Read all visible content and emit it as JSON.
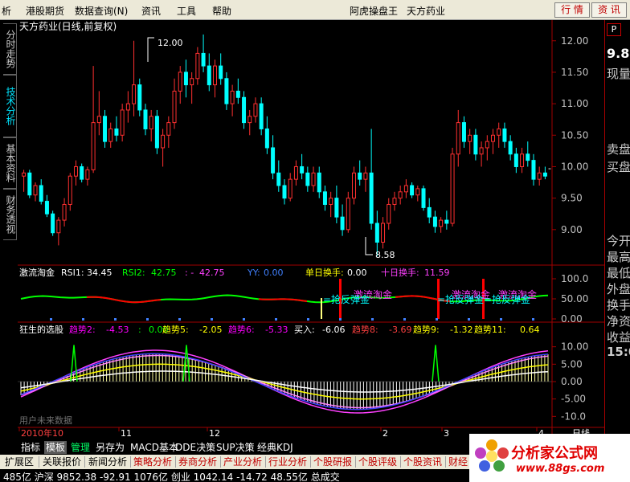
{
  "menubar": {
    "items": [
      "析",
      "港股期货",
      "数据查询(N)",
      "资讯",
      "工具",
      "帮助"
    ],
    "app_title": "阿虎操盘王",
    "stock_title": "天方药业",
    "btn_quote": "行 情",
    "btn_info": "资 讯",
    "win_min": "—",
    "win_restore": "❐",
    "win_close": "✕"
  },
  "left_tabs": [
    "分时走势",
    "技术分析",
    "基本资料",
    "财务透视"
  ],
  "chart": {
    "title": "天方药业(日线,前复权)",
    "high_label": "12.00",
    "low_label": "8.58",
    "price_ticks": [
      "12.00",
      "11.50",
      "11.00",
      "10.50",
      "10.00",
      "9.50",
      "9.00"
    ],
    "current_mark": "-",
    "candles": [
      [
        9.85,
        9.95,
        9.6,
        9.9
      ],
      [
        9.9,
        9.95,
        9.5,
        9.55
      ],
      [
        9.55,
        9.75,
        9.45,
        9.7
      ],
      [
        9.7,
        9.8,
        9.4,
        9.45
      ],
      [
        9.45,
        9.55,
        9.2,
        9.25
      ],
      [
        9.25,
        9.3,
        8.9,
        8.95
      ],
      [
        8.95,
        9.2,
        8.75,
        9.15
      ],
      [
        9.15,
        9.5,
        9.05,
        9.4
      ],
      [
        9.4,
        9.9,
        9.3,
        9.85
      ],
      [
        9.85,
        10.1,
        9.7,
        10.0
      ],
      [
        10.0,
        10.05,
        9.75,
        9.8
      ],
      [
        9.8,
        10.0,
        9.7,
        9.95
      ],
      [
        9.95,
        11.6,
        9.9,
        10.7
      ],
      [
        10.7,
        11.2,
        10.5,
        10.8
      ],
      [
        10.8,
        10.9,
        10.3,
        10.4
      ],
      [
        10.4,
        10.7,
        10.3,
        10.6
      ],
      [
        10.6,
        10.8,
        10.4,
        10.5
      ],
      [
        10.5,
        11.0,
        10.4,
        10.9
      ],
      [
        10.9,
        11.2,
        10.7,
        11.0
      ],
      [
        11.0,
        12.0,
        10.8,
        11.3
      ],
      [
        11.3,
        11.4,
        10.8,
        10.9
      ],
      [
        10.9,
        11.0,
        10.5,
        10.6
      ],
      [
        10.6,
        10.9,
        10.4,
        10.8
      ],
      [
        10.8,
        10.9,
        10.2,
        10.3
      ],
      [
        10.3,
        10.6,
        10.0,
        10.5
      ],
      [
        10.5,
        10.8,
        10.3,
        10.7
      ],
      [
        10.7,
        11.4,
        10.6,
        11.2
      ],
      [
        11.2,
        11.6,
        11.0,
        11.5
      ],
      [
        11.5,
        11.7,
        11.1,
        11.3
      ],
      [
        11.3,
        11.5,
        11.0,
        11.4
      ],
      [
        11.4,
        11.9,
        11.3,
        11.8
      ],
      [
        11.8,
        12.1,
        11.5,
        11.6
      ],
      [
        11.6,
        11.8,
        11.2,
        11.3
      ],
      [
        11.3,
        11.7,
        11.1,
        11.6
      ],
      [
        11.6,
        11.8,
        11.3,
        11.4
      ],
      [
        11.4,
        11.5,
        10.9,
        11.0
      ],
      [
        11.0,
        11.3,
        10.8,
        11.2
      ],
      [
        11.2,
        11.4,
        11.0,
        11.1
      ],
      [
        11.1,
        11.2,
        10.6,
        10.7
      ],
      [
        10.7,
        10.9,
        10.5,
        10.8
      ],
      [
        10.8,
        11.1,
        10.7,
        11.0
      ],
      [
        11.0,
        11.1,
        10.5,
        10.6
      ],
      [
        10.6,
        10.8,
        10.2,
        10.3
      ],
      [
        10.3,
        10.5,
        9.8,
        9.9
      ],
      [
        9.9,
        10.1,
        9.6,
        9.7
      ],
      [
        9.7,
        9.8,
        9.4,
        9.5
      ],
      [
        9.5,
        9.9,
        9.45,
        9.8
      ],
      [
        9.8,
        10.1,
        9.7,
        10.0
      ],
      [
        10.0,
        10.2,
        9.8,
        9.9
      ],
      [
        9.9,
        10.0,
        9.6,
        9.7
      ],
      [
        9.7,
        10.0,
        9.6,
        9.9
      ],
      [
        9.9,
        10.0,
        9.5,
        9.6
      ],
      [
        9.6,
        9.7,
        9.3,
        9.4
      ],
      [
        9.4,
        9.6,
        9.2,
        9.5
      ],
      [
        9.5,
        9.7,
        9.1,
        9.2
      ],
      [
        9.2,
        9.4,
        8.9,
        9.0
      ],
      [
        9.0,
        9.6,
        8.95,
        9.5
      ],
      [
        9.5,
        10.0,
        9.4,
        9.9
      ],
      [
        9.9,
        10.1,
        9.7,
        9.8
      ],
      [
        9.8,
        10.0,
        9.6,
        9.9
      ],
      [
        9.9,
        10.6,
        9.0,
        9.1
      ],
      [
        9.1,
        9.3,
        8.58,
        8.8
      ],
      [
        8.8,
        9.2,
        8.7,
        9.1
      ],
      [
        9.1,
        9.5,
        9.0,
        9.4
      ],
      [
        9.4,
        9.6,
        9.3,
        9.5
      ],
      [
        9.5,
        9.7,
        9.4,
        9.6
      ],
      [
        9.6,
        9.8,
        9.5,
        9.7
      ],
      [
        9.7,
        9.75,
        9.5,
        9.55
      ],
      [
        9.55,
        9.7,
        9.45,
        9.65
      ],
      [
        9.65,
        9.7,
        9.3,
        9.35
      ],
      [
        9.35,
        9.5,
        9.1,
        9.2
      ],
      [
        9.2,
        9.3,
        8.95,
        9.05
      ],
      [
        9.05,
        9.2,
        8.95,
        9.15
      ],
      [
        9.15,
        9.3,
        9.0,
        9.1
      ],
      [
        9.1,
        10.3,
        9.05,
        10.2
      ],
      [
        10.2,
        10.9,
        10.0,
        10.7
      ],
      [
        10.7,
        10.8,
        10.3,
        10.4
      ],
      [
        10.4,
        10.6,
        10.2,
        10.5
      ],
      [
        10.5,
        10.6,
        10.1,
        10.2
      ],
      [
        10.2,
        10.4,
        10.0,
        10.3
      ],
      [
        10.3,
        10.5,
        10.1,
        10.4
      ],
      [
        10.4,
        10.6,
        10.2,
        10.5
      ],
      [
        10.5,
        10.7,
        10.3,
        10.6
      ],
      [
        10.6,
        10.7,
        10.3,
        10.4
      ],
      [
        10.4,
        10.5,
        10.1,
        10.2
      ],
      [
        10.2,
        10.3,
        9.9,
        10.0
      ],
      [
        10.0,
        10.3,
        9.9,
        10.2
      ],
      [
        10.2,
        10.4,
        10.0,
        10.1
      ],
      [
        10.1,
        10.2,
        9.7,
        9.8
      ],
      [
        9.8,
        10.0,
        9.7,
        9.9
      ],
      [
        9.9,
        10.0,
        9.8,
        9.85
      ]
    ]
  },
  "rsi": {
    "name": "激流淘金",
    "rsi1_label": "RSI1:",
    "rsi1_value": "34.45",
    "rsi2_label": "RSI2:",
    "rsi2_value": "42.75",
    "extra_label": ": -",
    "extra_value": "42.75",
    "yy_label": "YY:",
    "yy_value": "0.00",
    "daily_label": "单日换手:",
    "daily_value": "0.00",
    "ten_label": "十日换手:",
    "ten_value": "11.59",
    "ticks": [
      "100.0",
      "50.00",
      "0.00"
    ],
    "sig_text": "激流淘金",
    "sig_text2": "=抢反弹金",
    "color_rsi1": "#00ff00",
    "color_rsi2": "#ff0000"
  },
  "trend": {
    "name": "狂生的选股",
    "items": [
      {
        "label": "趋势2:",
        "value": "-4.53",
        "color": "#ff00ff"
      },
      {
        "label": ":",
        "value": "0.00",
        "color": "#00ff00"
      },
      {
        "label": "趋势5:",
        "value": "-2.05",
        "color": "#ffff00"
      },
      {
        "label": "趋势6:",
        "value": "-5.33",
        "color": "#ff00ff"
      },
      {
        "label": "买入:",
        "value": "-6.06",
        "color": "#ffffff"
      },
      {
        "label": "趋势8:",
        "value": "-3.69",
        "color": "#ff4040"
      },
      {
        "label": "趋势9:",
        "value": "-1.32",
        "color": "#ffff00"
      },
      {
        "label": "趋势11:",
        "value": "0.64",
        "color": "#ffff00"
      }
    ],
    "ticks": [
      "10.00",
      "5.00",
      "0.00",
      "-5.00",
      "-10.0"
    ],
    "watermark": "用户未来数据"
  },
  "xaxis": {
    "labels": [
      "2010年10",
      "11",
      "12",
      "2",
      "3",
      "4"
    ],
    "period": "日线"
  },
  "right_panel": {
    "price": "9.8",
    "px_label": "现量",
    "sell": "卖盘",
    "buy": "买盘",
    "today": "今开",
    "high": "最高",
    "low": "最低",
    "out": "外盘",
    "turnover": "换手",
    "net": "净资",
    "income": "收益",
    "time": "15:0"
  },
  "bottom_tabs": [
    "指标",
    "模板",
    "管理",
    "另存为",
    "MACD基本",
    "DDE决策",
    "SUP决策",
    "经典KDJ"
  ],
  "bottom_nav": [
    "扩展区",
    "关联报价",
    "新闻分析",
    "策略分析",
    "券商分析",
    "产业分析",
    "行业分析",
    "个股研报",
    "个股评级",
    "个股资讯",
    "财经"
  ],
  "status": {
    "text": "485亿  沪深  9852.38  -92.91  1076亿  创业  1042.14  -14.72  48.55亿  总成交"
  },
  "logo": {
    "title": "分析家公式网",
    "url": "www.88gs.com"
  },
  "colors": {
    "up": "#ff3030",
    "down": "#00ffff",
    "axis": "#a00000",
    "tick": "#c0c0c0"
  }
}
